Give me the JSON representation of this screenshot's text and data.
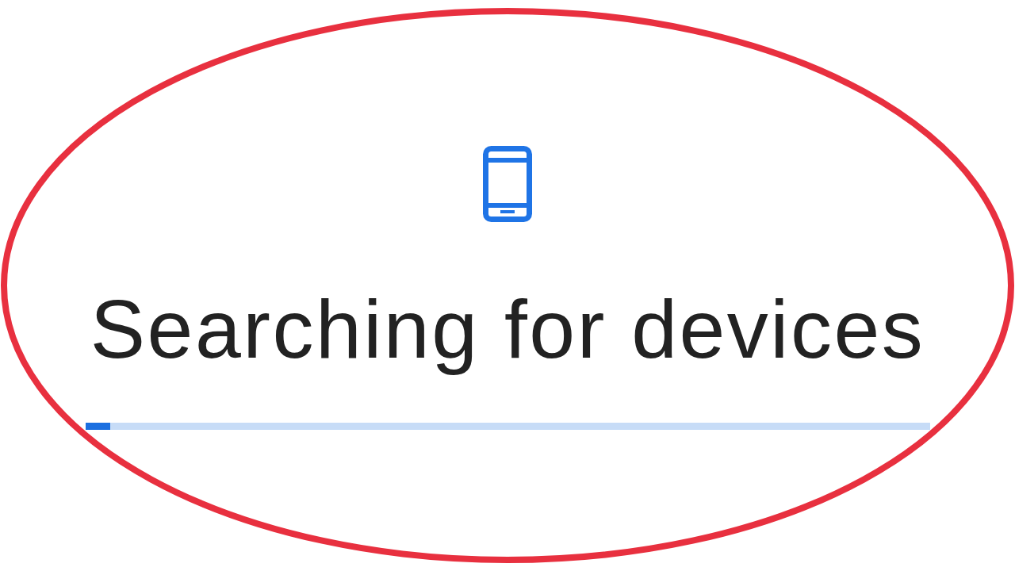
{
  "dialog": {
    "title": "Searching for devices",
    "progress": {
      "level": 0.03
    }
  },
  "annotation": {
    "kind": "ellipse"
  }
}
